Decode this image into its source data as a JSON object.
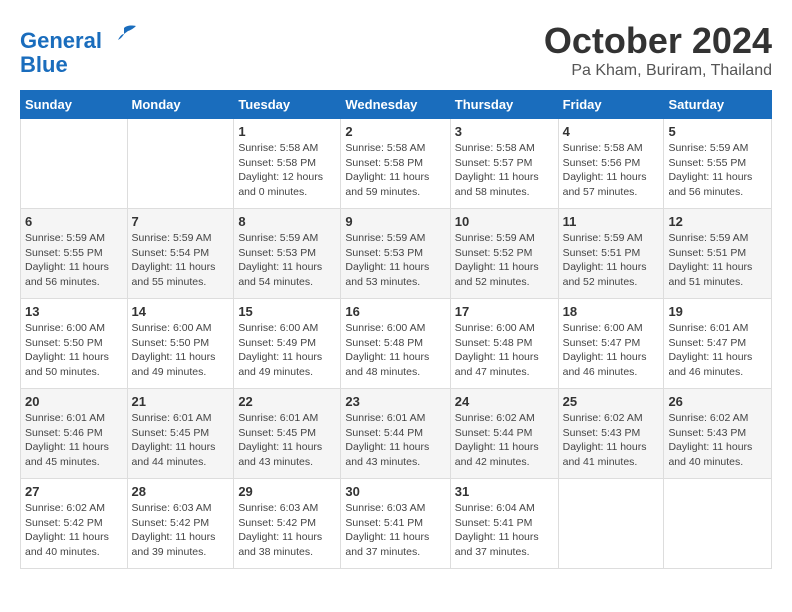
{
  "header": {
    "logo_line1": "General",
    "logo_line2": "Blue",
    "month": "October 2024",
    "location": "Pa Kham, Buriram, Thailand"
  },
  "days_of_week": [
    "Sunday",
    "Monday",
    "Tuesday",
    "Wednesday",
    "Thursday",
    "Friday",
    "Saturday"
  ],
  "weeks": [
    [
      {
        "day": "",
        "sunrise": "",
        "sunset": "",
        "daylight": ""
      },
      {
        "day": "",
        "sunrise": "",
        "sunset": "",
        "daylight": ""
      },
      {
        "day": "1",
        "sunrise": "Sunrise: 5:58 AM",
        "sunset": "Sunset: 5:58 PM",
        "daylight": "Daylight: 12 hours and 0 minutes."
      },
      {
        "day": "2",
        "sunrise": "Sunrise: 5:58 AM",
        "sunset": "Sunset: 5:58 PM",
        "daylight": "Daylight: 11 hours and 59 minutes."
      },
      {
        "day": "3",
        "sunrise": "Sunrise: 5:58 AM",
        "sunset": "Sunset: 5:57 PM",
        "daylight": "Daylight: 11 hours and 58 minutes."
      },
      {
        "day": "4",
        "sunrise": "Sunrise: 5:58 AM",
        "sunset": "Sunset: 5:56 PM",
        "daylight": "Daylight: 11 hours and 57 minutes."
      },
      {
        "day": "5",
        "sunrise": "Sunrise: 5:59 AM",
        "sunset": "Sunset: 5:55 PM",
        "daylight": "Daylight: 11 hours and 56 minutes."
      }
    ],
    [
      {
        "day": "6",
        "sunrise": "Sunrise: 5:59 AM",
        "sunset": "Sunset: 5:55 PM",
        "daylight": "Daylight: 11 hours and 56 minutes."
      },
      {
        "day": "7",
        "sunrise": "Sunrise: 5:59 AM",
        "sunset": "Sunset: 5:54 PM",
        "daylight": "Daylight: 11 hours and 55 minutes."
      },
      {
        "day": "8",
        "sunrise": "Sunrise: 5:59 AM",
        "sunset": "Sunset: 5:53 PM",
        "daylight": "Daylight: 11 hours and 54 minutes."
      },
      {
        "day": "9",
        "sunrise": "Sunrise: 5:59 AM",
        "sunset": "Sunset: 5:53 PM",
        "daylight": "Daylight: 11 hours and 53 minutes."
      },
      {
        "day": "10",
        "sunrise": "Sunrise: 5:59 AM",
        "sunset": "Sunset: 5:52 PM",
        "daylight": "Daylight: 11 hours and 52 minutes."
      },
      {
        "day": "11",
        "sunrise": "Sunrise: 5:59 AM",
        "sunset": "Sunset: 5:51 PM",
        "daylight": "Daylight: 11 hours and 52 minutes."
      },
      {
        "day": "12",
        "sunrise": "Sunrise: 5:59 AM",
        "sunset": "Sunset: 5:51 PM",
        "daylight": "Daylight: 11 hours and 51 minutes."
      }
    ],
    [
      {
        "day": "13",
        "sunrise": "Sunrise: 6:00 AM",
        "sunset": "Sunset: 5:50 PM",
        "daylight": "Daylight: 11 hours and 50 minutes."
      },
      {
        "day": "14",
        "sunrise": "Sunrise: 6:00 AM",
        "sunset": "Sunset: 5:50 PM",
        "daylight": "Daylight: 11 hours and 49 minutes."
      },
      {
        "day": "15",
        "sunrise": "Sunrise: 6:00 AM",
        "sunset": "Sunset: 5:49 PM",
        "daylight": "Daylight: 11 hours and 49 minutes."
      },
      {
        "day": "16",
        "sunrise": "Sunrise: 6:00 AM",
        "sunset": "Sunset: 5:48 PM",
        "daylight": "Daylight: 11 hours and 48 minutes."
      },
      {
        "day": "17",
        "sunrise": "Sunrise: 6:00 AM",
        "sunset": "Sunset: 5:48 PM",
        "daylight": "Daylight: 11 hours and 47 minutes."
      },
      {
        "day": "18",
        "sunrise": "Sunrise: 6:00 AM",
        "sunset": "Sunset: 5:47 PM",
        "daylight": "Daylight: 11 hours and 46 minutes."
      },
      {
        "day": "19",
        "sunrise": "Sunrise: 6:01 AM",
        "sunset": "Sunset: 5:47 PM",
        "daylight": "Daylight: 11 hours and 46 minutes."
      }
    ],
    [
      {
        "day": "20",
        "sunrise": "Sunrise: 6:01 AM",
        "sunset": "Sunset: 5:46 PM",
        "daylight": "Daylight: 11 hours and 45 minutes."
      },
      {
        "day": "21",
        "sunrise": "Sunrise: 6:01 AM",
        "sunset": "Sunset: 5:45 PM",
        "daylight": "Daylight: 11 hours and 44 minutes."
      },
      {
        "day": "22",
        "sunrise": "Sunrise: 6:01 AM",
        "sunset": "Sunset: 5:45 PM",
        "daylight": "Daylight: 11 hours and 43 minutes."
      },
      {
        "day": "23",
        "sunrise": "Sunrise: 6:01 AM",
        "sunset": "Sunset: 5:44 PM",
        "daylight": "Daylight: 11 hours and 43 minutes."
      },
      {
        "day": "24",
        "sunrise": "Sunrise: 6:02 AM",
        "sunset": "Sunset: 5:44 PM",
        "daylight": "Daylight: 11 hours and 42 minutes."
      },
      {
        "day": "25",
        "sunrise": "Sunrise: 6:02 AM",
        "sunset": "Sunset: 5:43 PM",
        "daylight": "Daylight: 11 hours and 41 minutes."
      },
      {
        "day": "26",
        "sunrise": "Sunrise: 6:02 AM",
        "sunset": "Sunset: 5:43 PM",
        "daylight": "Daylight: 11 hours and 40 minutes."
      }
    ],
    [
      {
        "day": "27",
        "sunrise": "Sunrise: 6:02 AM",
        "sunset": "Sunset: 5:42 PM",
        "daylight": "Daylight: 11 hours and 40 minutes."
      },
      {
        "day": "28",
        "sunrise": "Sunrise: 6:03 AM",
        "sunset": "Sunset: 5:42 PM",
        "daylight": "Daylight: 11 hours and 39 minutes."
      },
      {
        "day": "29",
        "sunrise": "Sunrise: 6:03 AM",
        "sunset": "Sunset: 5:42 PM",
        "daylight": "Daylight: 11 hours and 38 minutes."
      },
      {
        "day": "30",
        "sunrise": "Sunrise: 6:03 AM",
        "sunset": "Sunset: 5:41 PM",
        "daylight": "Daylight: 11 hours and 37 minutes."
      },
      {
        "day": "31",
        "sunrise": "Sunrise: 6:04 AM",
        "sunset": "Sunset: 5:41 PM",
        "daylight": "Daylight: 11 hours and 37 minutes."
      },
      {
        "day": "",
        "sunrise": "",
        "sunset": "",
        "daylight": ""
      },
      {
        "day": "",
        "sunrise": "",
        "sunset": "",
        "daylight": ""
      }
    ]
  ]
}
